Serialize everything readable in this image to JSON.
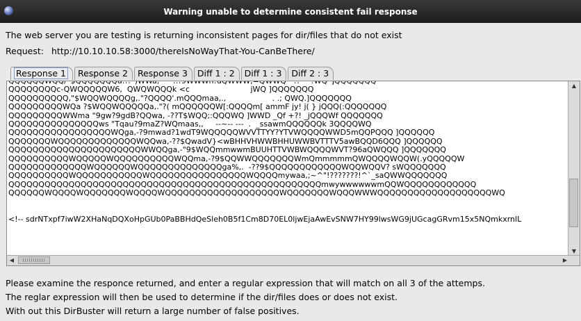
{
  "window": {
    "title": "Warning unable to determine consistent fail response",
    "icon": "app-icon"
  },
  "intro": "The web server you are testing is returning inconsistent pages for dir/files that do not exist",
  "request": {
    "label": "Request:",
    "url": "http://10.10.10.58:3000/thereIsNoWayThat-You-CanBeThere/"
  },
  "tabs": [
    "Response 1",
    "Response 2",
    "Response 3",
    "Diff 1 : 2",
    "Diff 1 : 3",
    "Diff 2 : 3"
  ],
  "active_tab": 0,
  "response_text": "QQQQQQWQQ/`$QQQQQQQa:!!`)WWa;`    ::!9WWWh!dQWWW,=QWWQ   !!`   !WQ`]QQQQQQQ\nQQQQQQQQc-QWQQQQQW6,  QWQWQQQk <c                         jWQ ]QQQQQQQ\nQQQQQQQQQQ,\"$WQQWQQQQg,.\"?QQQQ'.mQQQmaa,.,                   . .; QWQ.]QQQQQQQ\nQQQQQQQQQWQa ?$WQQWQQQQQa,.\"?( mQQQQQQW[:QQQQm[ ammF jy! j( } jQQQ(:QQQQQQQ\nQQQQQQQQQWWma \"9gw?9gdB?QQwa, -??T$WQQ;:QQQWQ ]WWD _Qf +?! _jQQQWf QQQQQQQ\nQQQQQQQQQQQQQQQws \"Tqau?9maZ?WQmaas,,     --~-- ---  .  _ssawmQQQQQQk 3QQQQWQ\nQQQQQQQQQQQQQQQQQWQga,-?9mwad?1wdT9WQQQQQWVVTTYY?YTVWQQQQWWD5mQQPQQQ ]QQQQQQ\nQQQQQQQWQQQQQQQQQQQQQWQQwa,-??$QwadV}<wBHHVHWWBHHUWWBVTTTV5awBQQD6QQQ ]QQQQQQ\nQQQQQQQQQQQQQQQQQQQQQQWWQQga,-\"9$WQQmmwwmBUUHTTVWBWQQQQWVT?96aQWQQQ ]QQQQQQQ\nQQQQQQQQQQWQQQQQWQQQQQQQQQQWQQma,-?9$QQWWQQQQQQQWmQmmmmmQWQQQQWQQW(.yQQQQQW\nQQQQQQQQQQQQQWQQQQQQWQQQQQQQQQQQQQQga%,.  -??9$QQQQQQQQQQQQWQQWQQV? sWQQQQQQQ\nQQQQQQQQQQWQQQQQQQQQQQWQQQQQQQQQQQQQQQQWQQQQmywaa,;~^\"!???????!^`_saQWWQQQQQQQ\nQQQQQQQQQQQQQQQQQQQQQQQQQQQQQQQQQQQQQQQQQQQQQQQQQQQQmwywwwwwwmQQWQQQQQQQQQQQQ\nQQQQQQWQQQQWQQQQQQQWQQQQWQQQQQQQQQQQQQQQQQQQWQQQQQQQWQQQWWWQQQQQQQQQQQQQQQQQQQWQ\n\n\n<!-- sdrNTxpf7iwW2XHaNqDQXoHpGUb0PaBBHdQeSleh0B5f1Cm8D70EL0ljwEjaAwEvSNW7HY99lwsWG9jUGcagGRvm15x5NQmkxrnlL",
  "footer": [
    "Please examine the responce returned, and enter a regular expression that will match on all 3 of the attemps.",
    "The reglar expression will then be used to determine if the dir/files does or does not exist.",
    "With out this DirBuster will return a large number of false positives."
  ],
  "scroll_glyphs": {
    "up": "▲",
    "down": "▼",
    "left": "◀",
    "right": "▶"
  }
}
